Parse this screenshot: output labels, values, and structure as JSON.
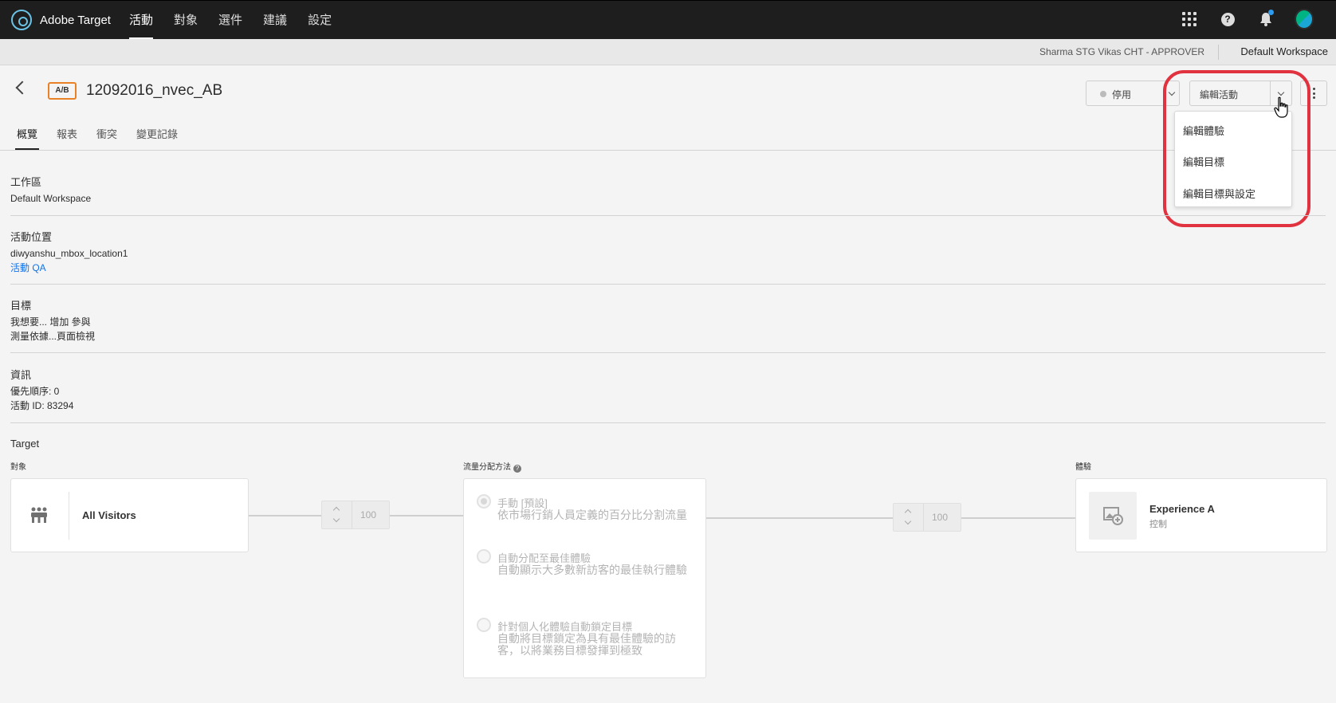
{
  "app": {
    "name": "Adobe Target"
  },
  "nav": {
    "items": [
      "活動",
      "對象",
      "選件",
      "建議",
      "設定"
    ]
  },
  "subbar": {
    "user": "Sharma STG Vikas CHT - APPROVER",
    "workspace": "Default Workspace"
  },
  "activity": {
    "badge": "A/B",
    "title": "12092016_nvec_AB"
  },
  "tabs": [
    "概覽",
    "報表",
    "衝突",
    "變更記錄"
  ],
  "status_button": {
    "label": "停用"
  },
  "edit_button": {
    "label": "編輯活動"
  },
  "edit_menu": {
    "items": [
      "編輯體驗",
      "編輯目標",
      "編輯目標與設定"
    ]
  },
  "sections": {
    "workspace": {
      "heading": "工作區",
      "value": "Default Workspace"
    },
    "location": {
      "heading": "活動位置",
      "value": "diwyanshu_mbox_location1",
      "link": "活動 QA"
    },
    "goal": {
      "heading": "目標",
      "line1": "我想要...   增加 參與",
      "line2": "測量依據...頁面檢視"
    },
    "info": {
      "heading": "資訊",
      "priority": "優先順序: 0",
      "activity_id": "活動 ID: 83294"
    }
  },
  "targeting": {
    "heading": "Target",
    "audience_label": "對象",
    "traffic_label": "流量分配方法",
    "experience_label": "體驗",
    "audience": "All Visitors",
    "audience_pct": "100",
    "experience_pct": "100",
    "options": [
      {
        "title": "手動 [預設]",
        "desc": "依市場行銷人員定義的百分比分割流量"
      },
      {
        "title": "自動分配至最佳體驗",
        "desc": "自動顯示大多數新訪客的最佳執行體驗"
      },
      {
        "title": "針對個人化體驗自動鎖定目標",
        "desc": "自動將目標鎖定為具有最佳體驗的訪客，以將業務目標發揮到極致"
      }
    ],
    "experience": {
      "name": "Experience A",
      "sub": "控制"
    }
  },
  "colors": {
    "accent_link": "#1473e6",
    "badge_border": "#e98127",
    "highlight": "#e0333f"
  }
}
